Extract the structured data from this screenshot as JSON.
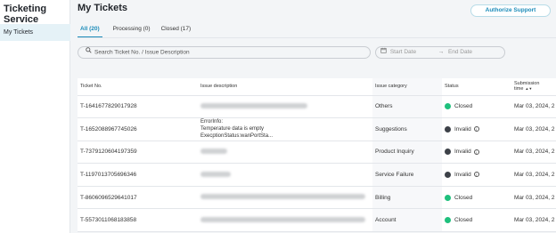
{
  "sidebar": {
    "app_title": "Ticketing Service",
    "items": [
      {
        "label": "My Tickets"
      }
    ]
  },
  "header": {
    "title": "My Tickets",
    "authorize_label": "Authorize Support"
  },
  "tabs": [
    {
      "label": "All (20)"
    },
    {
      "label": "Processing (0)"
    },
    {
      "label": "Closed (17)"
    }
  ],
  "search": {
    "placeholder": "Search Ticket No. / Issue Description"
  },
  "date_range": {
    "start_placeholder": "Start Date",
    "end_placeholder": "End Date"
  },
  "table": {
    "columns": {
      "ticket_no": "Ticket No.",
      "issue": "Issue description",
      "category": "Issue category",
      "status": "Status",
      "time": "Submission time"
    },
    "rows": [
      {
        "ticket_no": "T-1641677829017928",
        "category": "Others",
        "status": "Closed",
        "time": "Mar 03, 2024, 2"
      },
      {
        "ticket_no": "T-1652088967745026",
        "issue_lines": [
          "ErrorInfo:",
          "Temperature data is empty",
          "ExecptionStatus:wanPortSta..."
        ],
        "category": "Suggestions",
        "status": "Invalid",
        "time": "Mar 03, 2024, 2"
      },
      {
        "ticket_no": "T-7379120604197359",
        "category": "Product Inquiry",
        "status": "Invalid",
        "time": "Mar 03, 2024, 2"
      },
      {
        "ticket_no": "T-1197013705696346",
        "category": "Service Failure",
        "status": "Invalid",
        "time": "Mar 03, 2024, 2"
      },
      {
        "ticket_no": "T-8606096529641017",
        "category": "Billing",
        "status": "Closed",
        "time": "Mar 03, 2024, 2"
      },
      {
        "ticket_no": "T-5573011068183858",
        "category": "Account",
        "status": "Closed",
        "time": "Mar 03, 2024, 2"
      }
    ]
  },
  "colors": {
    "accent": "#1a8bb9",
    "closed": "#1fc07d",
    "invalid": "#3d4148"
  }
}
